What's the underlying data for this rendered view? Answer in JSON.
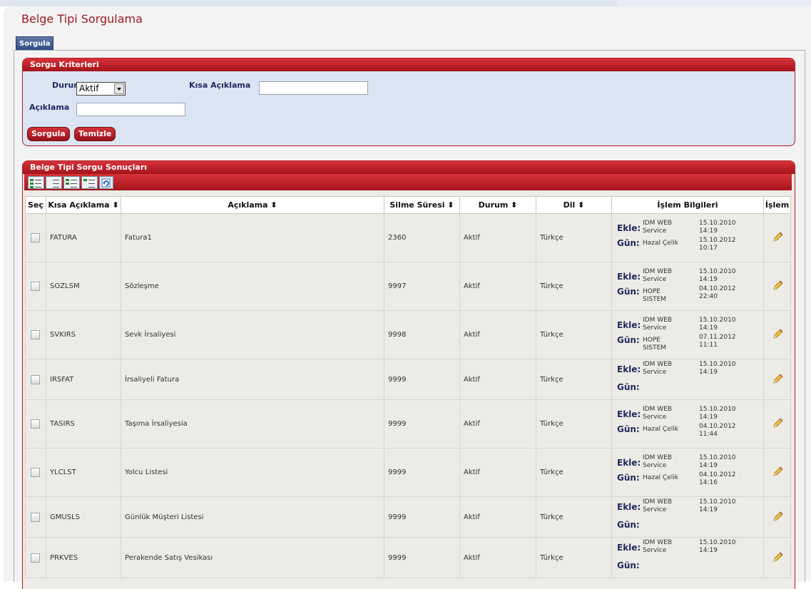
{
  "page_title": "Belge Tipi Sorgulama",
  "tab_label": "Sorgula",
  "criteria": {
    "title": "Sorgu Kriterleri",
    "durum_label": "Durum",
    "durum_value": "Aktif",
    "kisa_label": "Kısa Açıklama",
    "kisa_value": "",
    "aciklama_label": "Açıklama",
    "aciklama_value": "",
    "sorgula_btn": "Sorgula",
    "temizle_btn": "Temizle"
  },
  "results": {
    "title": "Belge Tipi Sorgu Sonuçları",
    "toolbar_icons": [
      "select-all-icon",
      "deselect-icon",
      "select-page-icon",
      "clear-selection-icon",
      "refresh-icon"
    ],
    "headers": {
      "sec": "Seç",
      "kisa": "Kısa Açıklama",
      "aciklama": "Açıklama",
      "silme": "Silme Süresi",
      "durum": "Durum",
      "dil": "Dil",
      "islem_bilgi": "İşlem Bilgileri",
      "islem": "İşlem"
    },
    "ekle_label": "Ekle:",
    "gun_label": "Gün:",
    "rows": [
      {
        "kisa": "FATURA",
        "aciklama": "Fatura1",
        "silme": "2360",
        "durum": "Aktif",
        "dil": "Türkçe",
        "ekle_user": "IDM WEB Service",
        "ekle_date": "15.10.2010 14:19",
        "gun_user": "Hazal Çelik",
        "gun_date": "15.10.2012 10:17"
      },
      {
        "kisa": "SOZLSM",
        "aciklama": "Sözleşme",
        "silme": "9997",
        "durum": "Aktif",
        "dil": "Türkçe",
        "ekle_user": "IDM WEB Service",
        "ekle_date": "15.10.2010 14:19",
        "gun_user": "HOPE SISTEM",
        "gun_date": "04.10.2012 22:40"
      },
      {
        "kisa": "SVKIRS",
        "aciklama": "Sevk İrsaliyesi",
        "silme": "9998",
        "durum": "Aktif",
        "dil": "Türkçe",
        "ekle_user": "IDM WEB Service",
        "ekle_date": "15.10.2010 14:19",
        "gun_user": "HOPE SISTEM",
        "gun_date": "07.11.2012 11:11"
      },
      {
        "kisa": "IRSFAT",
        "aciklama": "İrsaliyeli Fatura",
        "silme": "9999",
        "durum": "Aktif",
        "dil": "Türkçe",
        "ekle_user": "IDM WEB Service",
        "ekle_date": "15.10.2010 14:19",
        "gun_user": "",
        "gun_date": ""
      },
      {
        "kisa": "TASIRS",
        "aciklama": "Taşıma İrsaliyesia",
        "silme": "9999",
        "durum": "Aktif",
        "dil": "Türkçe",
        "ekle_user": "IDM WEB Service",
        "ekle_date": "15.10.2010 14:19",
        "gun_user": "Hazal Çelik",
        "gun_date": "04.10.2012 11:44"
      },
      {
        "kisa": "YLCLST",
        "aciklama": "Yolcu Listesi",
        "silme": "9999",
        "durum": "Aktif",
        "dil": "Türkçe",
        "ekle_user": "IDM WEB Service",
        "ekle_date": "15.10.2010 14:19",
        "gun_user": "Hazal Çelik",
        "gun_date": "04.10.2012 14:16"
      },
      {
        "kisa": "GMUSLS",
        "aciklama": "Günlük Müşteri Listesi",
        "silme": "9999",
        "durum": "Aktif",
        "dil": "Türkçe",
        "ekle_user": "IDM WEB Service",
        "ekle_date": "15.10.2010 14:19",
        "gun_user": "",
        "gun_date": ""
      },
      {
        "kisa": "PRKVES",
        "aciklama": "Perakende Satış Vesikası",
        "silme": "9999",
        "durum": "Aktif",
        "dil": "Türkçe",
        "ekle_user": "IDM WEB Service",
        "ekle_date": "15.10.2010 14:19",
        "gun_user": "",
        "gun_date": ""
      }
    ]
  }
}
